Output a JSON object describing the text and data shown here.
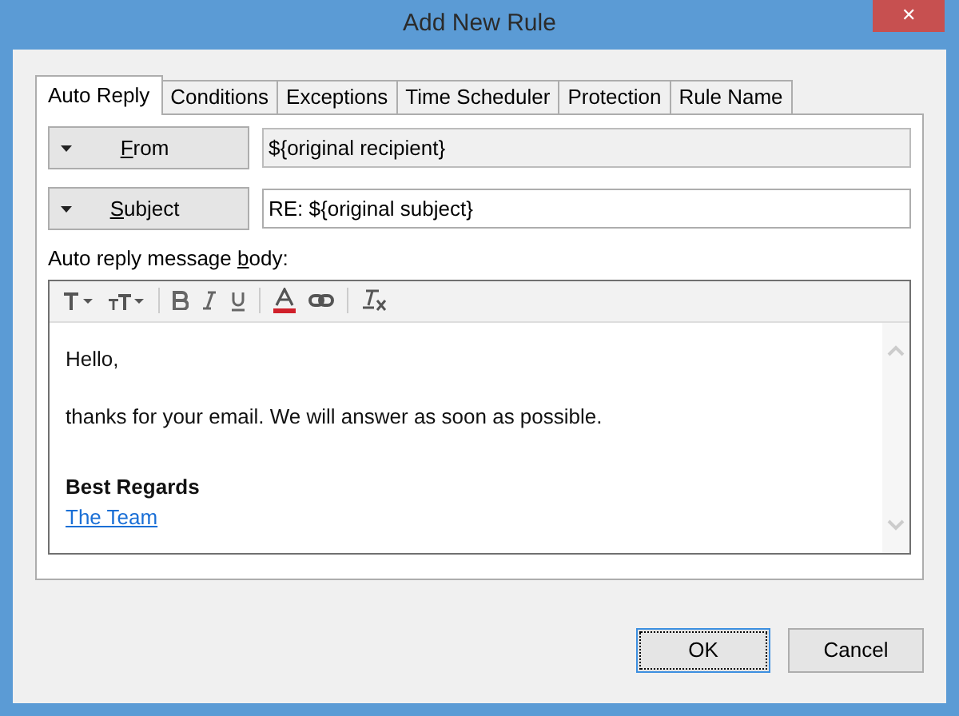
{
  "window": {
    "title": "Add New Rule",
    "close": "✕"
  },
  "tabs": [
    {
      "label": "Auto Reply",
      "selected": true
    },
    {
      "label": "Conditions",
      "selected": false
    },
    {
      "label": "Exceptions",
      "selected": false
    },
    {
      "label": "Time Scheduler",
      "selected": false
    },
    {
      "label": "Protection",
      "selected": false
    },
    {
      "label": "Rule Name",
      "selected": false
    }
  ],
  "fields": [
    {
      "button": {
        "key": "F",
        "rest": "rom"
      },
      "value": "${original recipient}",
      "disabled": true
    },
    {
      "button": {
        "key": "S",
        "rest": "ubject"
      },
      "value": "RE: ${original subject}",
      "disabled": false
    }
  ],
  "body_label": {
    "before": "Auto reply message ",
    "key": "b",
    "after": "ody:"
  },
  "message": [
    {
      "kind": "text",
      "text": "Hello,"
    },
    {
      "kind": "text",
      "text": "thanks for your email. We will answer as soon as possible."
    },
    {
      "kind": "bold",
      "text": "Best Regards"
    },
    {
      "kind": "link",
      "text": "The Team"
    }
  ],
  "buttons": [
    {
      "label": "OK",
      "default": true
    },
    {
      "label": "Cancel",
      "default": false
    }
  ]
}
